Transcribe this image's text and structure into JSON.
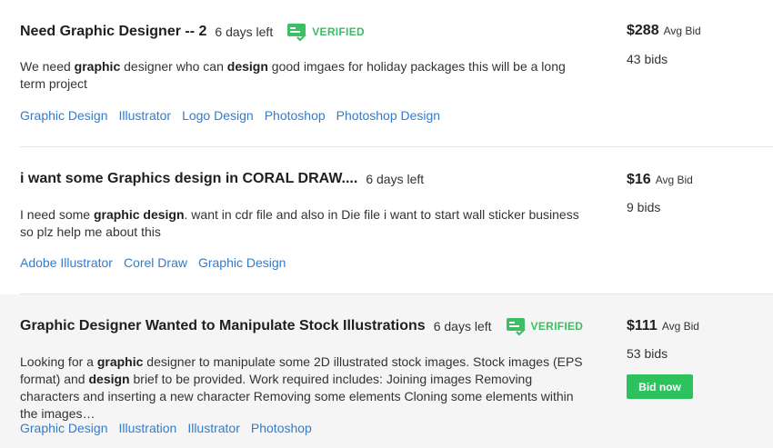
{
  "projects": [
    {
      "title": "Need Graphic Designer -- 2",
      "days_left": "6 days left",
      "verified": "VERIFIED",
      "description": [
        {
          "t": "We need ",
          "b": false
        },
        {
          "t": "graphic",
          "b": true
        },
        {
          "t": " designer who can ",
          "b": false
        },
        {
          "t": "design",
          "b": true
        },
        {
          "t": " good imgaes for holiday packages this will be a long term project",
          "b": false
        }
      ],
      "tags": [
        "Graphic Design",
        "Illustrator",
        "Logo Design",
        "Photoshop",
        "Photoshop Design"
      ],
      "price": "$288",
      "price_label": "Avg Bid",
      "bids": "43 bids"
    },
    {
      "title": "i want some Graphics design in CORAL DRAW....",
      "days_left": "6 days left",
      "description": [
        {
          "t": "I need some ",
          "b": false
        },
        {
          "t": "graphic design",
          "b": true
        },
        {
          "t": ". want in cdr file and also in Die file i want to start wall sticker business so plz help me about this",
          "b": false
        }
      ],
      "tags": [
        "Adobe Illustrator",
        "Corel Draw",
        "Graphic Design"
      ],
      "price": "$16",
      "price_label": "Avg Bid",
      "bids": "9 bids"
    },
    {
      "title": "Graphic Designer Wanted to Manipulate Stock Illustrations",
      "days_left": "6 days left",
      "verified": "VERIFIED",
      "description": [
        {
          "t": "Looking for a ",
          "b": false
        },
        {
          "t": "graphic",
          "b": true
        },
        {
          "t": " designer to manipulate some 2D illustrated stock images. Stock images (EPS format) and ",
          "b": false
        },
        {
          "t": "design",
          "b": true
        },
        {
          "t": " brief to be provided. Work required includes: Joining images Removing characters and inserting a new character Removing some elements Cloning some elements within the images…",
          "b": false
        }
      ],
      "tags": [
        "Graphic Design",
        "Illustration",
        "Illustrator",
        "Photoshop"
      ],
      "price": "$111",
      "price_label": "Avg Bid",
      "bids": "53 bids",
      "bid_button": "Bid now"
    }
  ],
  "colors": {
    "verified": "#3dbd64",
    "tag_link": "#2f7dd1",
    "bid_button": "#2ec25f",
    "highlight_bg": "#f5f5f5"
  }
}
